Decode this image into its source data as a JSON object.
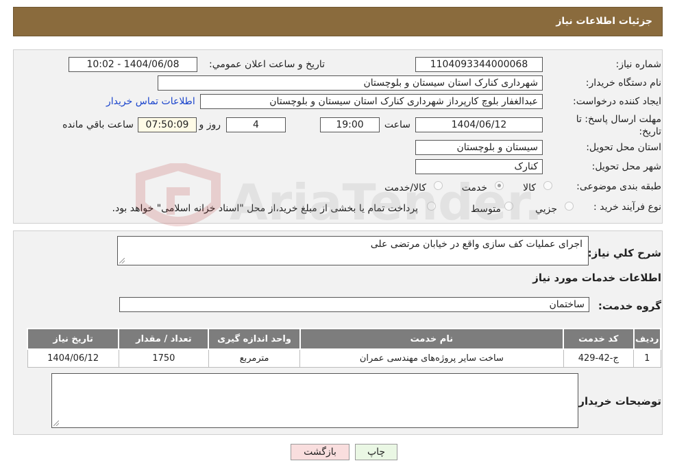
{
  "header": {
    "title": "جزئيات اطلاعات نياز"
  },
  "form": {
    "need_number": {
      "label": "شماره نياز:",
      "value": "1104093344000068"
    },
    "announce": {
      "label": "تاريخ و ساعت اعلان عمومي:",
      "value": "1404/06/08 - 10:02"
    },
    "buyer_org": {
      "label": "نام دستگاه خريدار:",
      "value": "شهرداری کنارک استان سیستان و بلوچستان"
    },
    "requester": {
      "label": "ايجاد کننده درخواست:",
      "value": "عبدالغفار بلوچ کارپرداز شهرداری کنارک استان سیستان و بلوچستان",
      "contact_link": "اطلاعات تماس خريدار"
    },
    "deadline": {
      "label_line1": "مهلت ارسال پاسخ: تا",
      "label_line2": "تاريخ:",
      "date": "1404/06/12",
      "time_label": "ساعت",
      "time": "19:00",
      "days": "4",
      "days_label": "روز و",
      "remaining": "07:50:09",
      "remaining_label": "ساعت باقي مانده"
    },
    "province": {
      "label": "استان محل تحويل:",
      "value": "سیستان و بلوچستان"
    },
    "city": {
      "label": "شهر محل تحويل:",
      "value": "کنارک"
    },
    "category": {
      "label": "طبقه بندی موضوعی:",
      "options": [
        "کالا",
        "خدمت",
        "کالا/خدمت"
      ],
      "selected": "خدمت"
    },
    "purchase_type": {
      "label": "نوع فرآيند خريد :",
      "options": [
        "جزيي",
        "متوسط"
      ],
      "note": "پرداخت تمام يا بخشی از مبلغ خريد،از محل \"اسناد خزانه اسلامی\" خواهد بود."
    }
  },
  "details": {
    "summary_label": "شرح کلي نياز:",
    "summary_value": "اجرای عملیات کف سازی واقع در خیابان مرتضی علی",
    "services_heading": "اطلاعات خدمات مورد نياز",
    "service_group_label": "گروه خدمت:",
    "service_group_value": "ساختمان",
    "table": {
      "headers": [
        "رديف",
        "کد خدمت",
        "نام خدمت",
        "واحد اندازه گيری",
        "تعداد / مقدار",
        "تاريخ نياز"
      ],
      "rows": [
        [
          "1",
          "ج-42-429",
          "ساخت سایر پروژه‌های مهندسی عمران",
          "مترمربع",
          "1750",
          "1404/06/12"
        ]
      ]
    },
    "buyer_notes_label": "توضيحات خريدار:",
    "buyer_notes_value": ""
  },
  "buttons": {
    "print": "چاپ",
    "back": "بازگشت"
  },
  "colors": {
    "header_bg": "#8a6b3d",
    "table_header_bg": "#7d7d7d",
    "link": "#1a44cc",
    "back_btn_bg": "#f9dede",
    "print_btn_bg": "#eaf7e4"
  },
  "watermark": {
    "text": "AriaTender.net"
  }
}
